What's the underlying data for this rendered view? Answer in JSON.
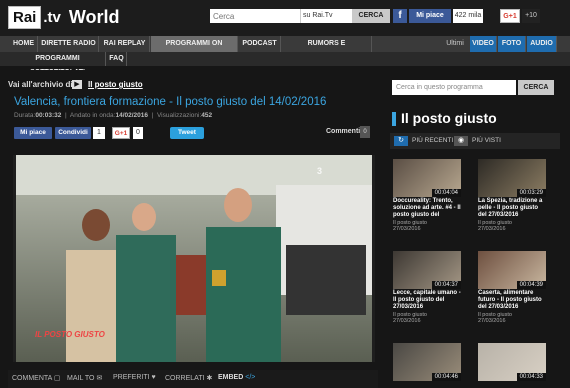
{
  "header": {
    "logo_rai": "Rai",
    "logo_tv": ".tv",
    "logo_world": "World",
    "search_placeholder": "Cerca",
    "search_scope": "su Rai.Tv",
    "search_button": "CERCA",
    "fb_icon": "f",
    "fb_like": "Mi piace",
    "fb_count": "422 mila",
    "gplus": "G+1",
    "gplus_count": "+10"
  },
  "nav": {
    "items": [
      "HOME",
      "DIRETTE RADIO",
      "RAI REPLAY",
      "PROGRAMMI ON DEMAND",
      "PODCAST",
      "RUMORS E ANTICIPAZIONI"
    ],
    "right_label": "Ultimi",
    "right_tabs": [
      "VIDEO",
      "FOTO",
      "AUDIO"
    ],
    "row2": [
      "PROGRAMMI SOTTOTITOLATI",
      "FAQ"
    ]
  },
  "main": {
    "archive_label": "Vai all'archivio di",
    "archive_arrow": "▶",
    "archive_link": "Il posto giusto",
    "title": "Valencia, frontiera formazione - Il posto giusto del 14/02/2016",
    "meta_durata_label": "Durata:",
    "meta_durata": "00:03:32",
    "meta_andato_label": "Andato in onda:",
    "meta_andato": "14/02/2016",
    "meta_vis_label": "Visualizzazioni:",
    "meta_vis": "452",
    "fb_like": "Mi piace",
    "fb_share": "Condividi",
    "fb_count": "1",
    "gplus": "G+1",
    "gplus_count": "0",
    "tweet": "Tweet",
    "comments_label": "Commenti",
    "comments_count": "0",
    "video_overlay": "IL POSTO GIUSTO",
    "channel_logo": "3"
  },
  "bottombar": {
    "commenta": "COMMENTA",
    "mail": "MAIL TO",
    "preferiti": "PREFERITI",
    "correlati": "CORRELATI",
    "embed": "EMBED"
  },
  "sidebar": {
    "search_placeholder": "Cerca in questo programma",
    "search_button": "CERCA",
    "title": "Il posto giusto",
    "tab_recent": "PIÙ RECENTI",
    "tab_visti": "PIÙ VISTI",
    "cards": [
      {
        "duration": "00:04:04",
        "title": "Doccureality: Trento, soluzione ad arte. #4 - Il posto giusto del",
        "sub": "Il posto giusto",
        "date": "27/03/2016"
      },
      {
        "duration": "00:03:29",
        "title": "La Spezia, tradizione a pelle - Il posto giusto del 27/03/2016",
        "sub": "Il posto giusto",
        "date": "27/03/2016"
      },
      {
        "duration": "00:04:37",
        "title": "Lecce, capitale umano - Il posto giusto del 27/03/2016",
        "sub": "Il posto giusto",
        "date": "27/03/2016"
      },
      {
        "duration": "00:04:39",
        "title": "Caserta, alimentare futuro - Il posto giusto del 27/03/2016",
        "sub": "Il posto giusto",
        "date": "27/03/2016"
      },
      {
        "duration": "00:04:46",
        "title": "",
        "sub": "",
        "date": ""
      },
      {
        "duration": "00:04:33",
        "title": "",
        "sub": "",
        "date": ""
      }
    ]
  }
}
